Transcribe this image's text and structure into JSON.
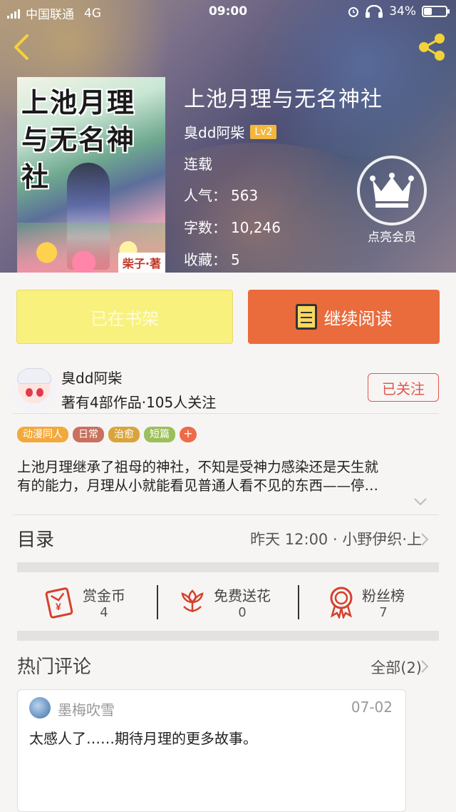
{
  "status_bar": {
    "carrier": "中国联通",
    "network": "4G",
    "time": "09:00",
    "battery_percent": "34%",
    "battery_level": 0.34
  },
  "book": {
    "title": "上池月理与无名神社",
    "cover_title": "上池月理与无名神社",
    "cover_pen_name": "柴子·著",
    "author": "臭dd阿柴",
    "author_level": "Lv2",
    "status": "连载",
    "popularity_label": "人气：",
    "popularity": "563",
    "words_label": "字数：",
    "words": "10,246",
    "favorites_label": "收藏：",
    "favorites": "5"
  },
  "vip": {
    "label": "点亮会员"
  },
  "actions": {
    "shelf_label": "已在书架",
    "read_label": "继续阅读"
  },
  "author_card": {
    "name": "臭dd阿柴",
    "stats": "著有4部作品·105人关注",
    "follow_label": "已关注"
  },
  "tags": [
    {
      "label": "动漫同人",
      "color": "#f2a93b"
    },
    {
      "label": "日常",
      "color": "#c9705e"
    },
    {
      "label": "治愈",
      "color": "#d9a43b"
    },
    {
      "label": "短篇",
      "color": "#9bbf5a"
    }
  ],
  "tag_more": "+",
  "description": {
    "line1": "上池月理继承了祖母的神社，不知是受神力感染还是天生就",
    "line2": "有的能力，月理从小就能看见普通人看不见的东西——停…"
  },
  "toc": {
    "label": "目录",
    "latest": "昨天 12:00 · 小野伊织·上"
  },
  "rewards": [
    {
      "name": "赏金币",
      "count": "4",
      "icon": "red-envelope-icon"
    },
    {
      "name": "免费送花",
      "count": "0",
      "icon": "flower-icon"
    },
    {
      "name": "粉丝榜",
      "count": "7",
      "icon": "medal-icon"
    }
  ],
  "comments": {
    "header": "热门评论",
    "all_label": "全部(2)",
    "items": [
      {
        "user": "墨梅吹雪",
        "date": "07-02",
        "text": "太感人了……期待月理的更多故事。"
      }
    ]
  },
  "colors": {
    "accent": "#ea6b3c",
    "shelf_button": "#f8f17e",
    "follow": "#e0584b",
    "reward_icon": "#d6402c",
    "level_badge": "#f3b73c"
  }
}
